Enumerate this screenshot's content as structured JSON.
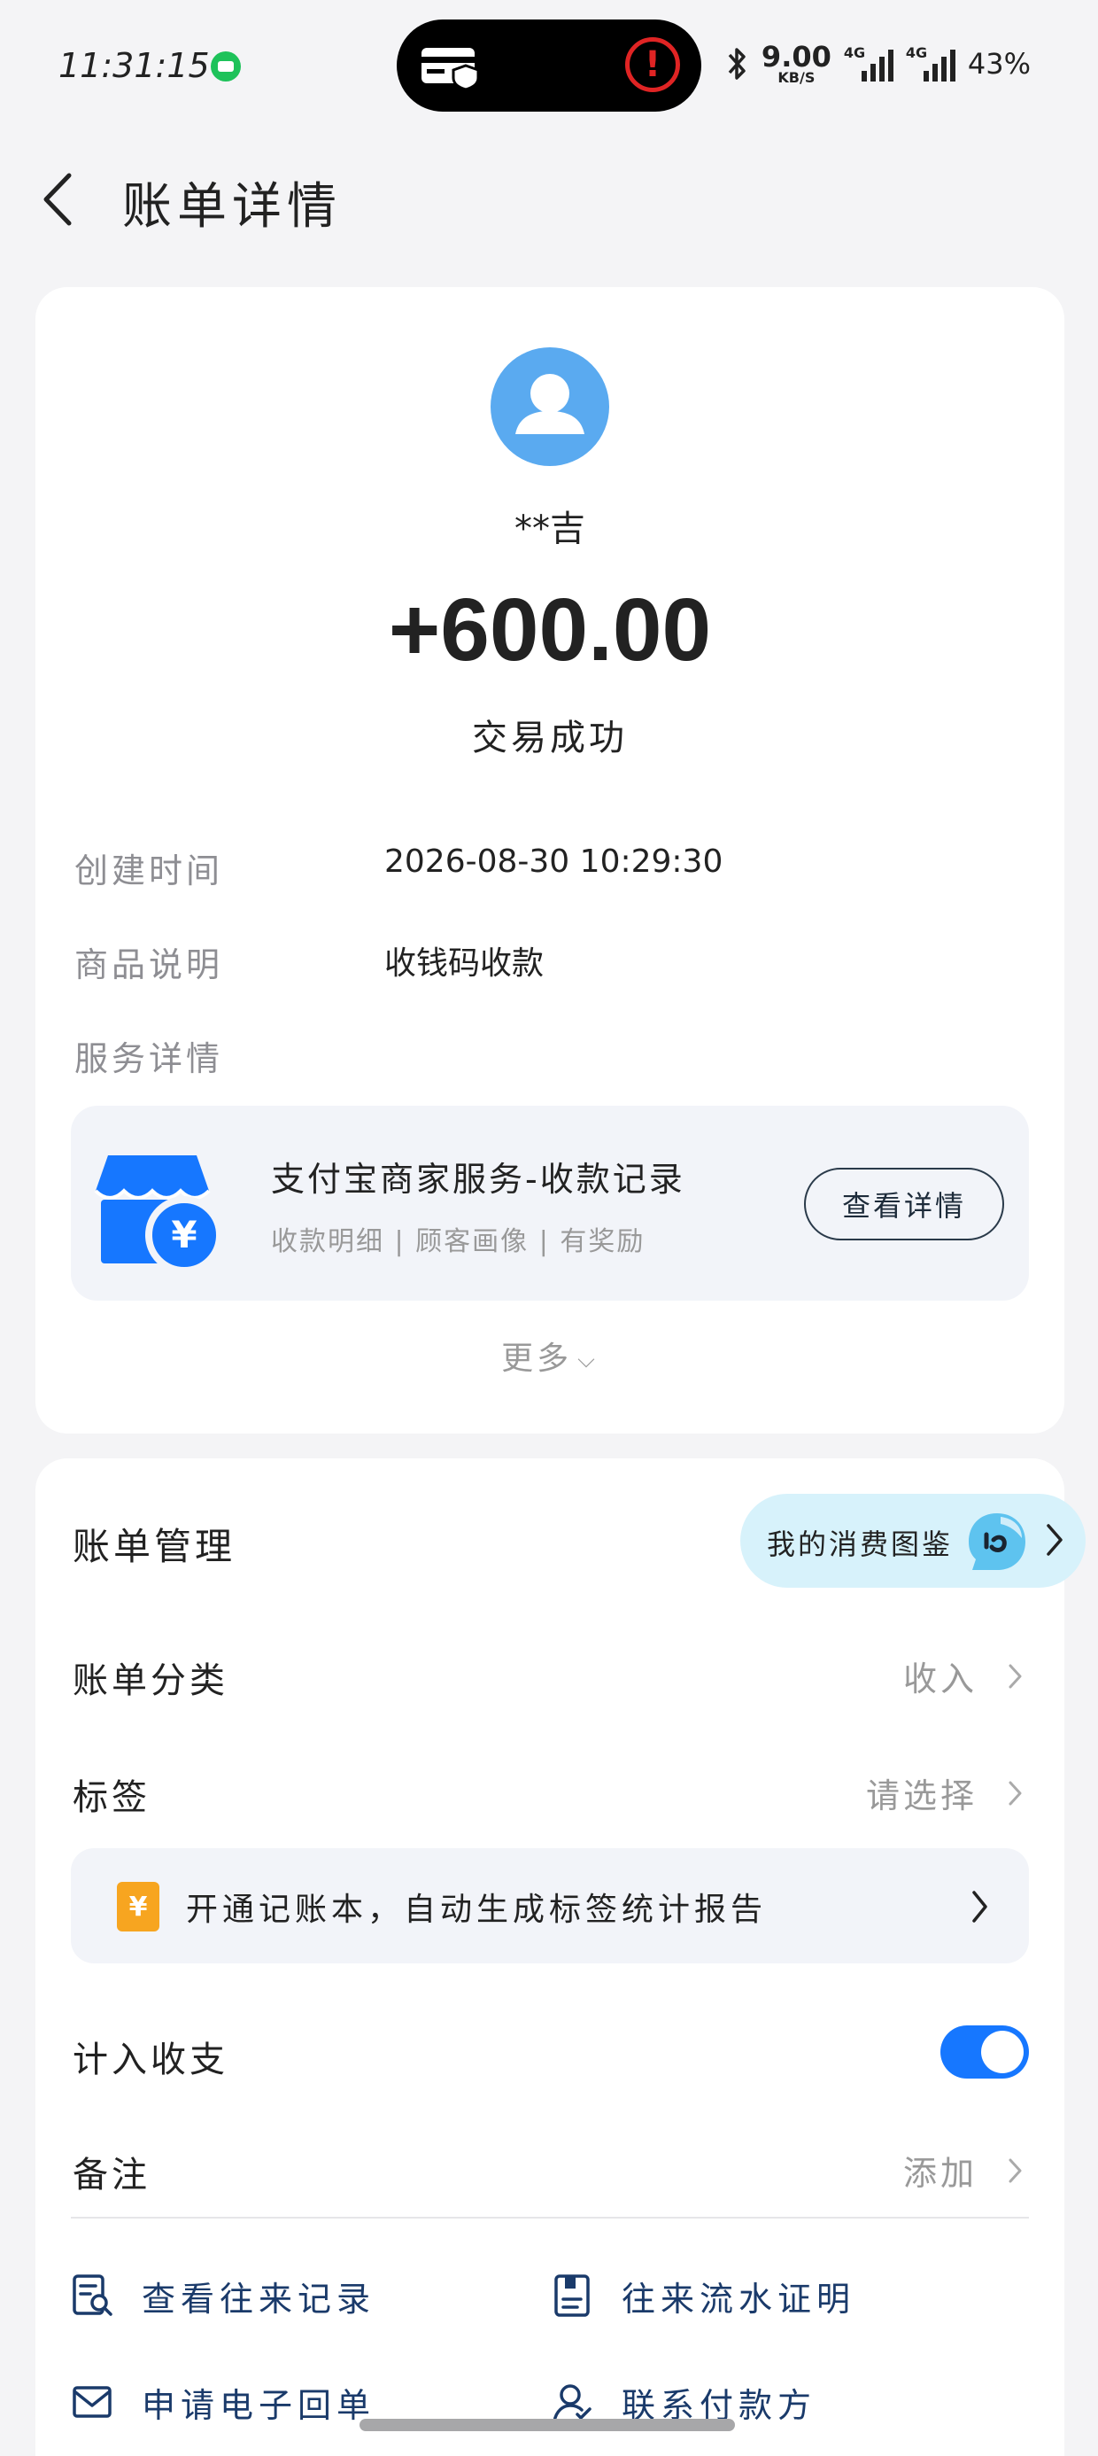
{
  "status_bar": {
    "time": "11:31:15",
    "net_speed_value": "9.00",
    "net_speed_unit": "KB/S",
    "signal_1_tag": "4G",
    "signal_2_tag": "4G",
    "battery": "43%"
  },
  "header": {
    "title": "账单详情"
  },
  "transaction": {
    "counterparty": "**吉",
    "amount": "+600.00",
    "status": "交易成功"
  },
  "details": {
    "created_label": "创建时间",
    "created_value": "2026-08-30 10:29:30",
    "product_label": "商品说明",
    "product_value": "收钱码收款",
    "service_label": "服务详情"
  },
  "service": {
    "title": "支付宝商家服务-收款记录",
    "subtitle": "收款明细 | 顾客画像 | 有奖励",
    "button": "查看详情"
  },
  "more": {
    "label": "更多"
  },
  "bill_management": {
    "title": "账单管理",
    "consumption_guide": "我的消费图鉴",
    "category_label": "账单分类",
    "category_value": "收入",
    "tag_label": "标签",
    "tag_value": "请选择",
    "ledger_banner": "开通记账本，自动生成标签统计报告",
    "ledger_icon": "¥",
    "count_label": "计入收支",
    "count_enabled": true,
    "note_label": "备注",
    "note_value": "添加"
  },
  "actions": {
    "view_records": "查看往来记录",
    "flow_proof": "往来流水证明",
    "e_receipt": "申请电子回单",
    "contact_payer": "联系付款方"
  },
  "colors": {
    "accent_blue": "#1677ff",
    "avatar_blue": "#5aaaf0",
    "link_navy": "#1a3a6a",
    "alert_red": "#e02424",
    "ledger_orange": "#f7a520",
    "guide_bg": "#d7f2fb"
  }
}
